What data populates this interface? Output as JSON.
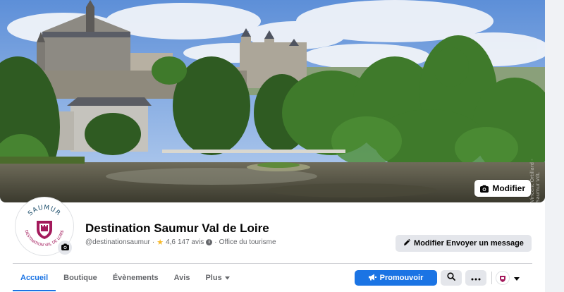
{
  "cover": {
    "credit": "Vincent Ortillard - Saumur VdL",
    "edit_label": "Modifier"
  },
  "avatar": {
    "logo_top": "SAUMUR",
    "logo_bottom": "DESTINATION VAL DE LOIRE"
  },
  "page": {
    "name": "Destination Saumur Val de Loire",
    "handle": "@destinationsaumur",
    "separator": "·",
    "rating": "4,6",
    "reviews": "147 avis",
    "category": "Office du tourisme"
  },
  "primary_action": {
    "label": "Modifier Envoyer un message"
  },
  "tabs": [
    {
      "label": "Accueil",
      "active": true
    },
    {
      "label": "Boutique",
      "active": false
    },
    {
      "label": "Évènements",
      "active": false
    },
    {
      "label": "Avis",
      "active": false
    },
    {
      "label": "Plus",
      "active": false
    }
  ],
  "actions": {
    "promote_label": "Promouvoir"
  },
  "colors": {
    "accent": "#1b74e4",
    "button_grey": "#e4e6eb",
    "brand_burgundy": "#a3195b",
    "brand_teal": "#1d4e6b"
  },
  "icons": {
    "camera": "camera-icon",
    "pencil": "pencil-icon",
    "megaphone": "megaphone-icon",
    "search": "search-icon",
    "more": "more-icon",
    "caret": "caret-down-icon"
  }
}
